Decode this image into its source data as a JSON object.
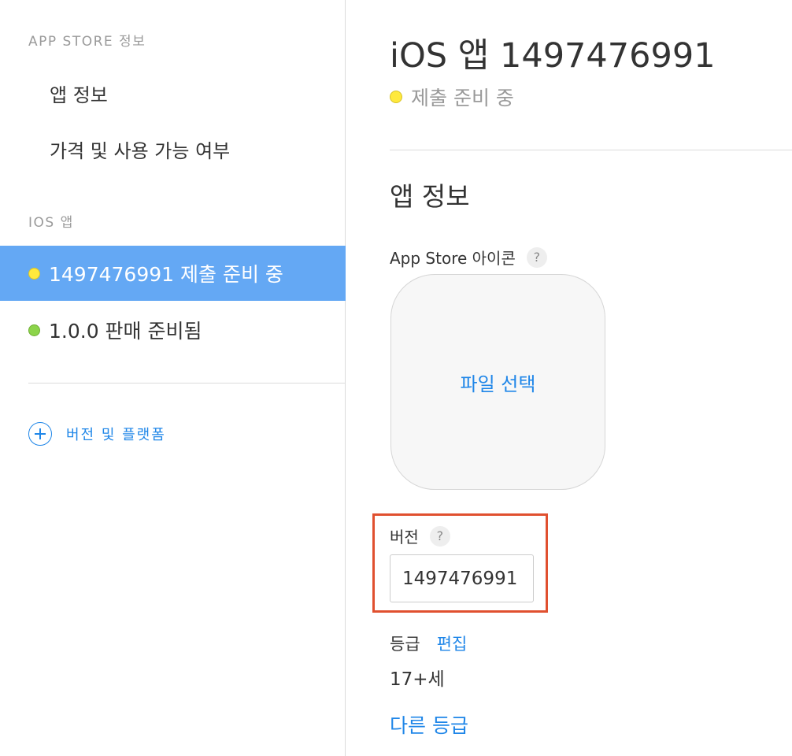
{
  "sidebar": {
    "app_store_heading": "APP STORE 정보",
    "app_store_links": [
      "앱 정보",
      "가격 및 사용 가능 여부"
    ],
    "ios_heading": "IOS 앱",
    "versions": [
      {
        "label": "1497476991 제출 준비 중",
        "status_color": "#ffe93d",
        "selected": true
      },
      {
        "label": "1.0.0 판매 준비됨",
        "status_color": "#8cd44a",
        "selected": false
      }
    ],
    "add_platform_label": "버전 및 플랫폼"
  },
  "main": {
    "title": "iOS 앱 1497476991",
    "status_text": "제출 준비 중",
    "status_color": "#ffe93d",
    "section_title": "앱 정보",
    "icon_label": "App Store 아이콘",
    "help_glyph": "?",
    "choose_file_label": "파일 선택",
    "version_label": "버전",
    "version_value": "1497476991",
    "rating_label": "등급",
    "rating_edit_label": "편집",
    "rating_value": "17+세",
    "other_ratings_label": "다른 등급"
  },
  "colors": {
    "accent": "#1f86e8",
    "selected_row": "#64a8f4",
    "highlight_box": "#e0502f"
  }
}
